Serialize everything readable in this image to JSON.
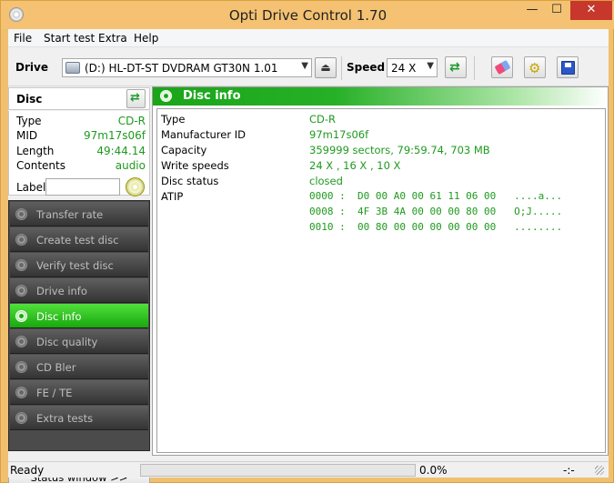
{
  "window": {
    "title": "Opti Drive Control 1.70",
    "min": "—",
    "max": "☐",
    "close": "✕"
  },
  "menu": [
    "File",
    "Start test",
    "Extra",
    "Help"
  ],
  "toolbar": {
    "drive_label": "Drive",
    "drive_value": "(D:)   HL-DT-ST DVDRAM GT30N 1.01",
    "eject_glyph": "⏏",
    "speed_label": "Speed",
    "speed_value": "24 X",
    "dropdown_arrow": "▼",
    "refresh_glyph": "⇄",
    "settings_glyph": "⚙"
  },
  "disc": {
    "header": "Disc",
    "refresh_glyph": "⇄",
    "props": [
      {
        "k": "Type",
        "v": "CD-R"
      },
      {
        "k": "MID",
        "v": "97m17s06f"
      },
      {
        "k": "Length",
        "v": "49:44.14"
      },
      {
        "k": "Contents",
        "v": "audio"
      }
    ],
    "label_key": "Label",
    "label_value": ""
  },
  "nav": [
    {
      "label": "Transfer rate",
      "active": false
    },
    {
      "label": "Create test disc",
      "active": false
    },
    {
      "label": "Verify test disc",
      "active": false
    },
    {
      "label": "Drive info",
      "active": false
    },
    {
      "label": "Disc info",
      "active": true
    },
    {
      "label": "Disc quality",
      "active": false
    },
    {
      "label": "CD Bler",
      "active": false
    },
    {
      "label": "FE / TE",
      "active": false
    },
    {
      "label": "Extra tests",
      "active": false
    }
  ],
  "status_window_btn": "Status window >>",
  "main": {
    "title": "Disc info",
    "rows": [
      {
        "k": "Type",
        "v": "CD-R"
      },
      {
        "k": "Manufacturer ID",
        "v": "97m17s06f"
      },
      {
        "k": "Capacity",
        "v": "359999 sectors, 79:59.74, 703 MB"
      },
      {
        "k": "Write speeds",
        "v": "24 X , 16 X , 10 X"
      },
      {
        "k": "Disc status",
        "v": "closed"
      },
      {
        "k": "ATIP",
        "v": ""
      }
    ],
    "atip": [
      "0000 :  D0 00 A0 00 61 11 06 00   ....a...",
      "0008 :  4F 3B 4A 00 00 00 80 00   O;J.....",
      "0010 :  00 80 00 00 00 00 00 00   ........"
    ]
  },
  "statusbar": {
    "text": "Ready",
    "progress": 0.0,
    "progress_text": "0.0%",
    "right": "-:-"
  },
  "colors": {
    "accent_green": "#1aa51a",
    "value_green": "#1e9a1e",
    "title_bar": "#f4c272",
    "close_red": "#c7372b"
  }
}
